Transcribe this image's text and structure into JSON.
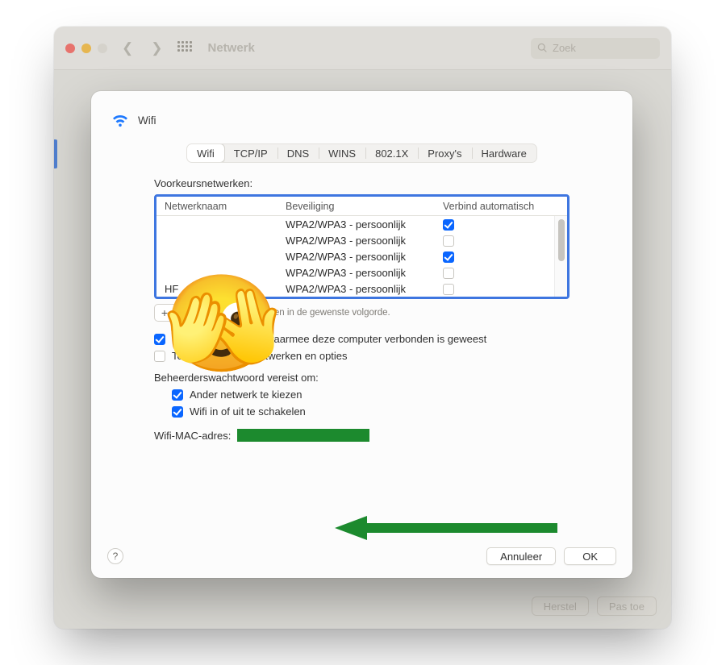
{
  "parent": {
    "title": "Netwerk",
    "search_placeholder": "Zoek",
    "buttons": {
      "revert": "Herstel",
      "apply": "Pas toe"
    }
  },
  "sheet": {
    "title": "Wifi",
    "tabs": [
      "Wifi",
      "TCP/IP",
      "DNS",
      "WINS",
      "802.1X",
      "Proxy's",
      "Hardware"
    ],
    "active_tab": 0,
    "preferred_label": "Voorkeursnetwerken:",
    "columns": {
      "name": "Netwerknaam",
      "security": "Beveiliging",
      "auto": "Verbind automatisch"
    },
    "networks": [
      {
        "name": "",
        "security": "WPA2/WPA3 - persoonlijk",
        "auto": true
      },
      {
        "name": "",
        "security": "WPA2/WPA3 - persoonlijk",
        "auto": false
      },
      {
        "name": "",
        "security": "WPA2/WPA3 - persoonlijk",
        "auto": true
      },
      {
        "name": "",
        "security": "WPA2/WPA3 - persoonlijk",
        "auto": false
      },
      {
        "name": "HF",
        "security": "WPA2/WPA3 - persoonlijk",
        "auto": false
      }
    ],
    "drag_hint": "Sleep de netwerken in de gewenste volgorde.",
    "remember": {
      "label": "Onthoud netwerken waarmee deze computer verbonden is geweest",
      "checked": true
    },
    "show_legacy": {
      "label": "Toon verouderde netwerken en opties",
      "checked": false
    },
    "admin_heading": "Beheerderswachtwoord vereist om:",
    "admin_opts": [
      {
        "label": "Ander netwerk te kiezen",
        "checked": true
      },
      {
        "label": "Wifi in of uit te schakelen",
        "checked": true
      }
    ],
    "mac_label": "Wifi-MAC-adres:",
    "buttons": {
      "cancel": "Annuleer",
      "ok": "OK"
    },
    "help": "?"
  },
  "overlay_emoji": "🫣"
}
